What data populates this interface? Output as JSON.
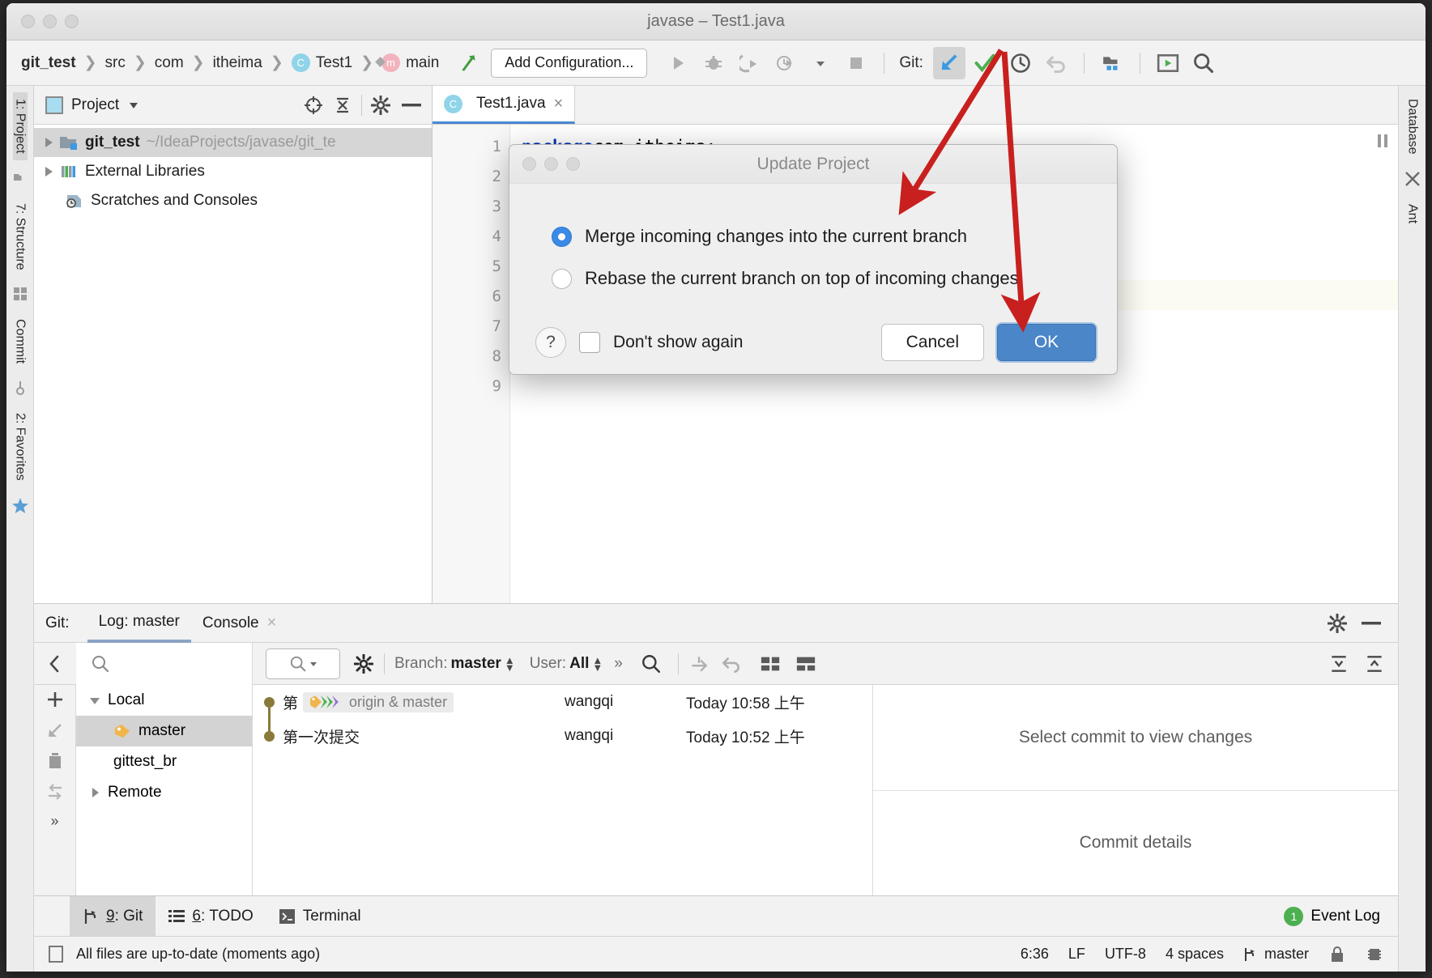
{
  "window": {
    "title": "javase – Test1.java"
  },
  "navbar": {
    "breadcrumbs": [
      {
        "label": "git_test",
        "type": "project"
      },
      {
        "label": "src",
        "type": "folder"
      },
      {
        "label": "com",
        "type": "folder"
      },
      {
        "label": "itheima",
        "type": "folder"
      },
      {
        "label": "Test1",
        "type": "class",
        "badge": "C"
      },
      {
        "label": "main",
        "type": "method",
        "badge": "m"
      }
    ],
    "separator": "❯",
    "add_configuration": "Add Configuration...",
    "git_label": "Git:",
    "icons": [
      "run-icon",
      "debug-icon",
      "run-coverage-icon",
      "profile-icon",
      "stop-icon",
      "update-project-icon",
      "commit-icon",
      "history-icon",
      "rollback-icon",
      "project-structure-icon",
      "presentation-icon",
      "search-everywhere-icon"
    ]
  },
  "left_rail": {
    "items": [
      {
        "label": "1: Project",
        "selected": true
      },
      {
        "label": "7: Structure",
        "selected": false
      },
      {
        "label": "Commit",
        "selected": false
      },
      {
        "label": "2: Favorites",
        "selected": false
      }
    ]
  },
  "right_rail": {
    "items": [
      {
        "label": "Database"
      },
      {
        "label": "Ant"
      }
    ]
  },
  "project_panel": {
    "title": "Project",
    "tree": [
      {
        "name": "git_test",
        "path": "~/IdeaProjects/javase/git_te",
        "bold": true,
        "selected": true,
        "expandable": true
      },
      {
        "name": "External Libraries",
        "path": "",
        "bold": false,
        "selected": false,
        "expandable": true
      },
      {
        "name": "Scratches and Consoles",
        "path": "",
        "bold": false,
        "selected": false,
        "expandable": false
      }
    ]
  },
  "editor": {
    "tab": {
      "label": "Test1.java",
      "badge": "C",
      "close": "×"
    },
    "line_numbers": [
      "1",
      "2",
      "3",
      "4",
      "5",
      "6",
      "7",
      "8",
      "9"
    ],
    "code_line_1": "package com.itheima;",
    "code_keyword": "package",
    "code_rest": " com.itheima;"
  },
  "dialog": {
    "title": "Update Project",
    "options": [
      {
        "label": "Merge incoming changes into the current branch",
        "selected": true
      },
      {
        "label": "Rebase the current branch on top of incoming changes",
        "selected": false
      }
    ],
    "help": "?",
    "dont_show_again": "Don't show again",
    "cancel": "Cancel",
    "ok": "OK"
  },
  "git_panel": {
    "label": "Git:",
    "tabs": [
      {
        "label": "Log: master",
        "selected": true,
        "closable": false
      },
      {
        "label": "Console",
        "selected": false,
        "closable": true,
        "close": "×"
      }
    ],
    "filters": {
      "branch_label": "Branch:",
      "branch_value": "master",
      "user_label": "User:",
      "user_value": "All",
      "more": "»",
      "search_placeholder": ""
    },
    "branch_tree": [
      {
        "label": "Local",
        "type": "group",
        "expanded": true,
        "selected": false
      },
      {
        "label": "master",
        "type": "branch",
        "selected": true
      },
      {
        "label": "gittest_br",
        "type": "branch",
        "selected": false
      },
      {
        "label": "Remote",
        "type": "group",
        "expanded": false,
        "selected": false
      }
    ],
    "commits": [
      {
        "message": "第",
        "refs": "origin & master",
        "author": "wangqi",
        "date": "Today 10:58 上午"
      },
      {
        "message": "第一次提交",
        "refs": "",
        "author": "wangqi",
        "date": "Today 10:52 上午"
      }
    ],
    "details": {
      "select_commit": "Select commit to view changes",
      "commit_details": "Commit details"
    }
  },
  "bottom_tabs": [
    {
      "num": "9",
      "label": "Git",
      "selected": true,
      "icon": "git-branch-icon"
    },
    {
      "num": "6",
      "label": "TODO",
      "selected": false,
      "icon": "todo-list-icon"
    },
    {
      "num": "",
      "label": "Terminal",
      "selected": false,
      "icon": "terminal-icon"
    }
  ],
  "event_log": {
    "label": "Event Log",
    "count": "1"
  },
  "status_bar": {
    "message": "All files are up-to-date (moments ago)",
    "position": "6:36",
    "line_separator": "LF",
    "encoding": "UTF-8",
    "indent": "4 spaces",
    "branch": "master"
  },
  "colors": {
    "accent_blue": "#4a86c8",
    "radio_blue": "#3a8ae8",
    "arrow_red": "#c8201e",
    "git_update_blue": "#3d9ae0",
    "commit_green": "#4caf50"
  }
}
